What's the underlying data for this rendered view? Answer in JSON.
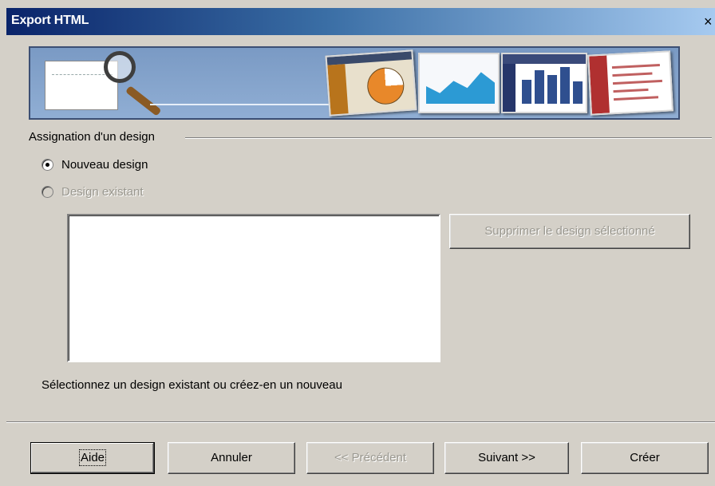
{
  "window": {
    "title": "Export HTML",
    "close_glyph": "×"
  },
  "banner": {
    "icons": [
      "magnifier-icon",
      "pie-chart-icon",
      "area-chart-icon",
      "bar-chart-icon",
      "text-page-icon"
    ]
  },
  "design_group": {
    "label": "Assignation d'un design",
    "options": [
      {
        "label": "Nouveau design",
        "checked": true,
        "enabled": true
      },
      {
        "label": "Design existant",
        "checked": false,
        "enabled": false
      }
    ],
    "delete_button": "Supprimer le design sélectionné",
    "hint": "Sélectionnez un design existant ou créez-en un nouveau"
  },
  "buttons": {
    "help": "Aide",
    "cancel": "Annuler",
    "previous": "<< Précédent",
    "next": "Suivant >>",
    "create": "Créer"
  },
  "colors": {
    "dialog_bg": "#d4d0c8",
    "title_gradient_start": "#0a246a",
    "title_gradient_end": "#a6caf0",
    "disabled_text": "#9a9890"
  }
}
